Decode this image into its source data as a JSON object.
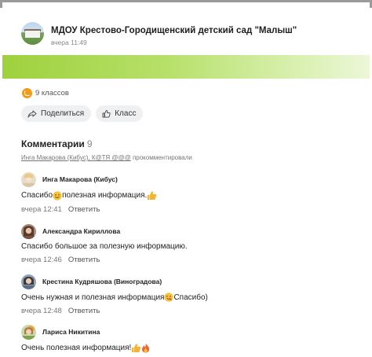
{
  "post": {
    "group_name": "МДОУ Крестово-Городищенский детский сад \"Малыш\"",
    "time": "вчера 11:49"
  },
  "klass": {
    "count_label": "9 классов"
  },
  "actions": {
    "share_label": "Поделиться",
    "klass_label": "Класс"
  },
  "comments_section": {
    "title": "Комментарии",
    "count": "9",
    "commenters_names": "Инга Макарова (Кибус), К@ТЯ @@@",
    "commenters_suffix": " прокомментировали"
  },
  "comments": [
    {
      "author": "Инга Макарова (Кибус)",
      "text_before": "Спасибо",
      "text_after": " полезная информация. ",
      "time": "вчера 12:41",
      "reply": "Ответить"
    },
    {
      "author": "Александра Кириллова",
      "text": "Спасибо большое за полезную информацию.",
      "time": "вчера 12:46",
      "reply": "Ответить"
    },
    {
      "author": "Крестина Кудряшова (Виноградова)",
      "text_before": "Очень нужная и полезная информация ",
      "text_after": "Спасибо)",
      "time": "вчера 12:48",
      "reply": "Ответить"
    },
    {
      "author": "Лариса Никитина",
      "text_before": "Очень полезная информация! "
    }
  ],
  "icons": {
    "klass": "thumbs-up-circle-icon",
    "share": "share-arrow-icon",
    "like": "thumbs-up-icon",
    "emoji_smile": "smiling-face-icon",
    "emoji_thumb": "thumbs-up-emoji-icon",
    "emoji_wink": "winking-face-icon",
    "emoji_fire": "fire-emoji-icon"
  },
  "colors": {
    "banner_green": "#9ed13d",
    "klass_orange": "#ee9b1f",
    "button_bg": "#eef0f2"
  }
}
